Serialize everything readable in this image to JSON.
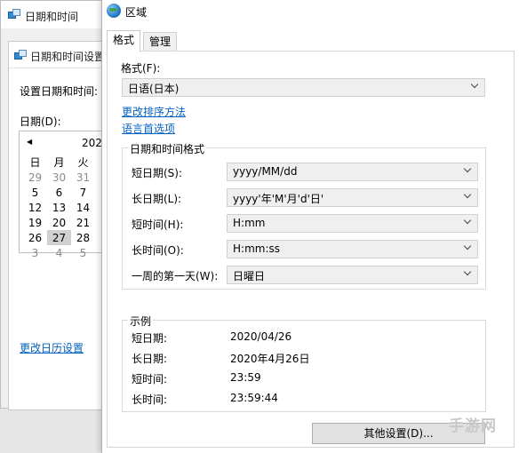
{
  "bg_window": {
    "title": "日期和时间"
  },
  "bg_dialog": {
    "title": "日期和时间设置",
    "set_label": "设置日期和时间:",
    "date_label": "日期(D):",
    "calendar": {
      "nav": "◀",
      "year": "202",
      "weekdays": [
        "日",
        "月",
        "火"
      ],
      "rows": [
        [
          "29",
          "30",
          "31"
        ],
        [
          "5",
          "6",
          "7"
        ],
        [
          "12",
          "13",
          "14"
        ],
        [
          "19",
          "20",
          "21"
        ],
        [
          "26",
          "27",
          "28"
        ],
        [
          "3",
          "4",
          "5"
        ]
      ],
      "selected": "27"
    },
    "link": "更改日历设置"
  },
  "dialog": {
    "title": "区域",
    "tabs": [
      "格式",
      "管理"
    ],
    "format_label": "格式(F):",
    "format_value": "日语(日本)",
    "link_sort": "更改排序方法",
    "link_lang": "语言首选项",
    "group_title": "日期和时间格式",
    "rows": [
      {
        "label": "短日期(S):",
        "value": "yyyy/MM/dd"
      },
      {
        "label": "长日期(L):",
        "value": "yyyy'年'M'月'd'日'"
      },
      {
        "label": "短时间(H):",
        "value": "H:mm"
      },
      {
        "label": "长时间(O):",
        "value": "H:mm:ss"
      },
      {
        "label": "一周的第一天(W):",
        "value": "日曜日"
      }
    ],
    "example_title": "示例",
    "examples": [
      {
        "label": "短日期:",
        "value": "2020/04/26"
      },
      {
        "label": "长日期:",
        "value": "2020年4月26日"
      },
      {
        "label": "短时间:",
        "value": "23:59"
      },
      {
        "label": "长时间:",
        "value": "23:59:44"
      }
    ],
    "other_button": "其他设置(D)..."
  },
  "watermark": "手游网"
}
